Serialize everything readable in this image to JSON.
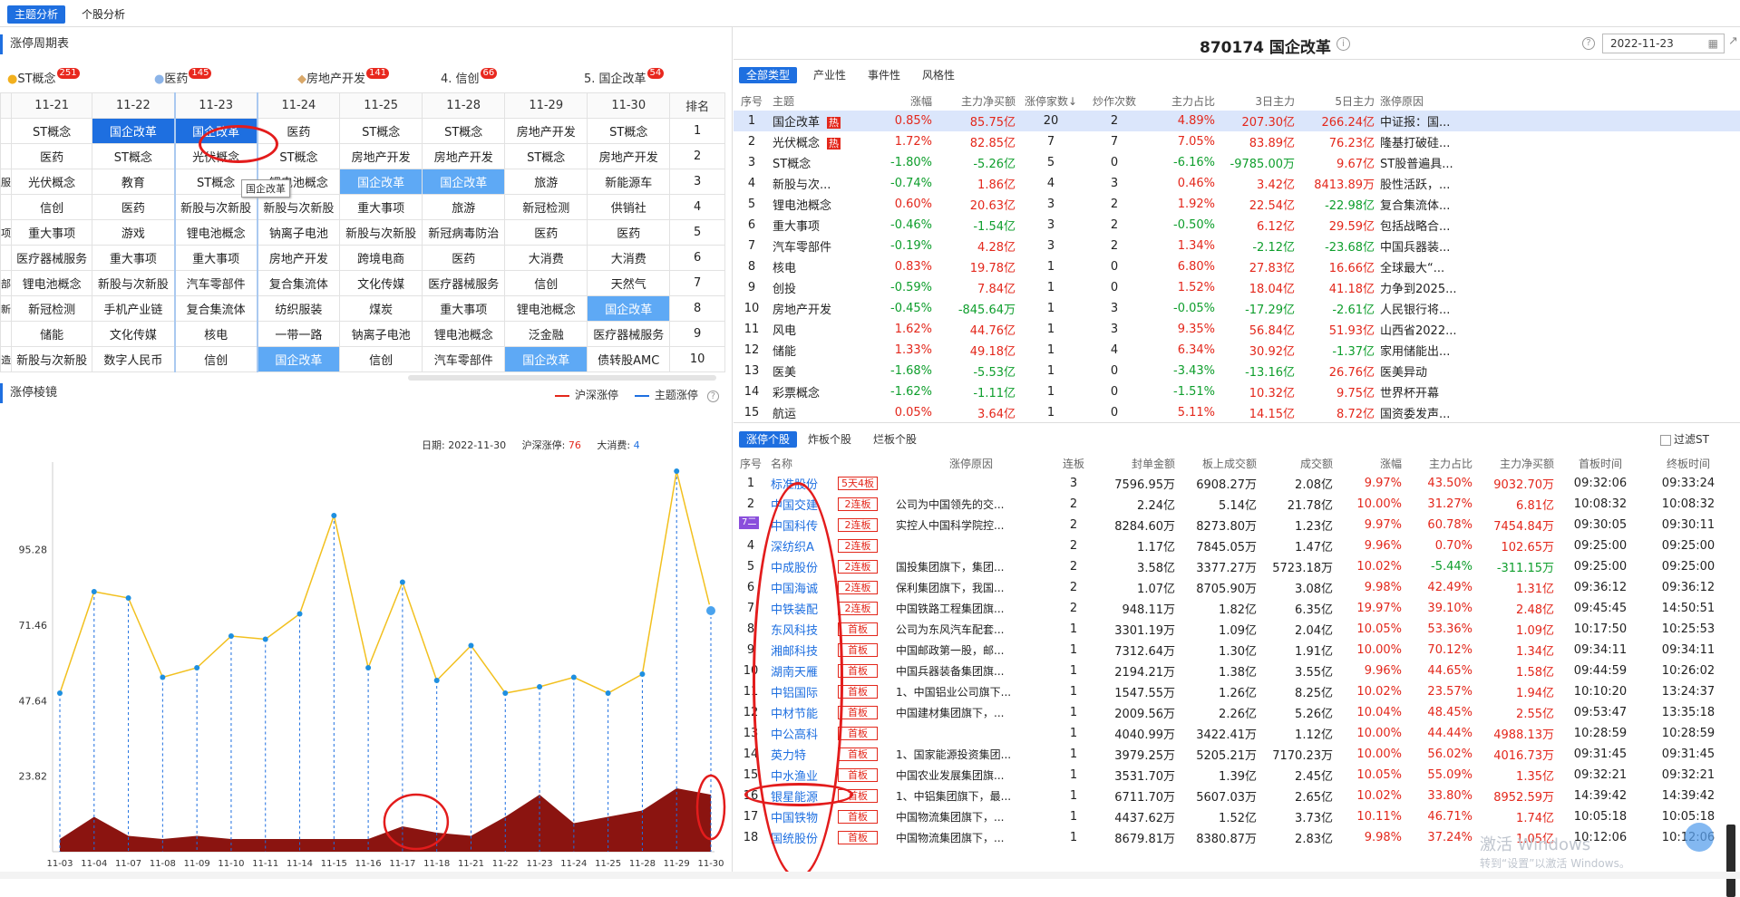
{
  "top_tabs": [
    "主题分析",
    "个股分析"
  ],
  "left": {
    "cycle_title": "涨停周期表",
    "theme_tabs": [
      {
        "label": "ST概念",
        "count": "251"
      },
      {
        "label": "医药",
        "count": "145"
      },
      {
        "label": "房地产开发",
        "count": "141"
      },
      {
        "label": "4. 信创",
        "count": "66"
      },
      {
        "label": "5. 国企改革",
        "count": "54"
      }
    ],
    "dates": [
      "11-21",
      "11-22",
      "11-23",
      "11-24",
      "11-25",
      "11-28",
      "11-29",
      "11-30",
      "排名"
    ],
    "rows": [
      [
        "ST概念",
        "国企改革",
        "国企改革",
        "医药",
        "ST概念",
        "ST概念",
        "房地产开发",
        "ST概念",
        "1"
      ],
      [
        "医药",
        "ST概念",
        "光伏概念",
        "ST概念",
        "房地产开发",
        "房地产开发",
        "ST概念",
        "房地产开发",
        "2"
      ],
      [
        "光伏概念",
        "教育",
        "ST概念",
        "锂电池概念",
        "国企改革",
        "国企改革",
        "旅游",
        "新能源车",
        "3"
      ],
      [
        "信创",
        "医药",
        "新股与次新股",
        "新股与次新股",
        "重大事项",
        "旅游",
        "新冠检测",
        "供销社",
        "4"
      ],
      [
        "重大事项",
        "游戏",
        "锂电池概念",
        "钠离子电池",
        "新股与次新股",
        "新冠病毒防治",
        "医药",
        "医药",
        "5"
      ],
      [
        "医疗器械服务",
        "重大事项",
        "重大事项",
        "房地产开发",
        "跨境电商",
        "医药",
        "大消费",
        "大消费",
        "6"
      ],
      [
        "锂电池概念",
        "新股与次新股",
        "汽车零部件",
        "复合集流体",
        "文化传媒",
        "医疗器械服务",
        "信创",
        "天然气",
        "7"
      ],
      [
        "新冠检测",
        "手机产业链",
        "复合集流体",
        "纺织服装",
        "煤炭",
        "重大事项",
        "锂电池概念",
        "国企改革",
        "8"
      ],
      [
        "储能",
        "文化传媒",
        "核电",
        "一带一路",
        "钠离子电池",
        "锂电池概念",
        "泛金融",
        "医疗器械服务",
        "9"
      ],
      [
        "新股与次新股",
        "数字人民币",
        "信创",
        "国企改革",
        "信创",
        "汽车零部件",
        "国企改革",
        "债转股AMC",
        "10"
      ]
    ],
    "row_prefix": [
      "",
      "",
      "服务",
      "",
      "项",
      "",
      "部件",
      "新股",
      "",
      "造"
    ],
    "tooltip": "国企改革",
    "mirror_title": "涨停棱镜",
    "legend": {
      "a": "沪深涨停",
      "b": "主题涨停"
    },
    "info": {
      "date_label": "日期:",
      "date": "2022-11-30",
      "hs_label": "沪深涨停:",
      "hs": "76",
      "theme_label": "大消费:",
      "theme": "4"
    }
  },
  "chart_data": {
    "type": "line",
    "categories": [
      "11-03",
      "11-04",
      "11-07",
      "11-08",
      "11-09",
      "11-10",
      "11-11",
      "11-14",
      "11-15",
      "11-16",
      "11-17",
      "11-18",
      "11-21",
      "11-22",
      "11-23",
      "11-24",
      "11-25",
      "11-28",
      "11-29",
      "11-30"
    ],
    "yticks": [
      23.82,
      47.64,
      71.46,
      95.28
    ],
    "ylim": [
      0,
      120
    ],
    "series": [
      {
        "name": "沪深涨停",
        "type": "area",
        "color": "#8b1410",
        "values": [
          4,
          11,
          5,
          4,
          5,
          4,
          4,
          4,
          4,
          4,
          8,
          6,
          5,
          11,
          18,
          9,
          11,
          13,
          20,
          18
        ]
      },
      {
        "name": "主题涨停",
        "type": "line",
        "color": "#f2c01e",
        "values": [
          50,
          82,
          80,
          55,
          58,
          68,
          67,
          75,
          106,
          58,
          85,
          54,
          65,
          50,
          52,
          55,
          50,
          56,
          120,
          76
        ]
      }
    ]
  },
  "right": {
    "header_title": "870174 国企改革",
    "date": "2022-11-23",
    "tabs1": [
      "全部类型",
      "产业性",
      "事件性",
      "风格性"
    ],
    "cols1": [
      "序号",
      "主题",
      "涨幅",
      "主力净买额",
      "涨停家数↓",
      "炒作次数",
      "主力占比",
      "3日主力",
      "5日主力",
      "涨停原因"
    ],
    "rows1": [
      [
        "1",
        "国企改革",
        "0.85%",
        "85.75亿",
        "20",
        "2",
        "4.89%",
        "207.30亿",
        "266.24亿",
        "中证报：国..."
      ],
      [
        "2",
        "光伏概念",
        "1.72%",
        "82.85亿",
        "7",
        "7",
        "7.05%",
        "83.89亿",
        "76.23亿",
        "隆基打破硅..."
      ],
      [
        "3",
        "ST概念",
        "-1.80%",
        "-5.26亿",
        "5",
        "0",
        "-6.16%",
        "-9785.00万",
        "9.67亿",
        "ST股普遍具..."
      ],
      [
        "4",
        "新股与次...",
        "-0.74%",
        "1.86亿",
        "4",
        "3",
        "0.46%",
        "3.42亿",
        "8413.89万",
        "股性活跃，..."
      ],
      [
        "5",
        "锂电池概念",
        "0.60%",
        "20.63亿",
        "3",
        "2",
        "1.92%",
        "22.54亿",
        "-22.98亿",
        "复合集流体..."
      ],
      [
        "6",
        "重大事项",
        "-0.46%",
        "-1.54亿",
        "3",
        "2",
        "-0.50%",
        "6.12亿",
        "29.59亿",
        "包括战略合..."
      ],
      [
        "7",
        "汽车零部件",
        "-0.19%",
        "4.28亿",
        "3",
        "2",
        "1.34%",
        "-2.12亿",
        "-23.68亿",
        "中国兵器装..."
      ],
      [
        "8",
        "核电",
        "0.83%",
        "19.78亿",
        "1",
        "0",
        "6.80%",
        "27.83亿",
        "16.66亿",
        "全球最大“..."
      ],
      [
        "9",
        "创投",
        "-0.59%",
        "7.84亿",
        "1",
        "0",
        "1.52%",
        "18.04亿",
        "41.18亿",
        "力争到2025..."
      ],
      [
        "10",
        "房地产开发",
        "-0.45%",
        "-845.64万",
        "1",
        "3",
        "-0.05%",
        "-17.29亿",
        "-2.61亿",
        "人民银行将..."
      ],
      [
        "11",
        "风电",
        "1.62%",
        "44.76亿",
        "1",
        "3",
        "9.35%",
        "56.84亿",
        "51.93亿",
        "山西省2022..."
      ],
      [
        "12",
        "储能",
        "1.33%",
        "49.18亿",
        "1",
        "4",
        "6.34%",
        "30.92亿",
        "-1.37亿",
        "家用储能出..."
      ],
      [
        "13",
        "医美",
        "-1.68%",
        "-5.53亿",
        "1",
        "0",
        "-3.43%",
        "-13.16亿",
        "26.76亿",
        "医美异动"
      ],
      [
        "14",
        "彩票概念",
        "-1.62%",
        "-1.11亿",
        "1",
        "0",
        "-1.51%",
        "10.32亿",
        "9.75亿",
        "世界杯开幕"
      ],
      [
        "15",
        "航运",
        "0.05%",
        "3.64亿",
        "1",
        "0",
        "5.11%",
        "14.15亿",
        "8.72亿",
        "国资委发声..."
      ]
    ],
    "hot_label": "热",
    "tabs2": [
      "涨停个股",
      "炸板个股",
      "烂板个股"
    ],
    "filter_label": "过滤ST",
    "cols2": [
      "序号",
      "名称",
      "",
      "涨停原因",
      "连板",
      "封单金额",
      "板上成交额",
      "成交额",
      "涨幅",
      "主力占比",
      "主力净买额",
      "首板时间",
      "终板时间"
    ],
    "rows2": [
      [
        "1",
        "标准股份",
        "5天4板",
        "",
        "3",
        "7596.95万",
        "6908.27万",
        "2.08亿",
        "9.97%",
        "43.50%",
        "9032.70万",
        "09:32:06",
        "09:33:24"
      ],
      [
        "2",
        "中国交建",
        "2连板",
        "公司为中国领先的交...",
        "2",
        "2.24亿",
        "5.14亿",
        "21.78亿",
        "10.00%",
        "31.27%",
        "6.81亿",
        "10:08:32",
        "10:08:32"
      ],
      [
        "3",
        "中国科传",
        "2连板",
        "实控人中国科学院控...",
        "2",
        "8284.60万",
        "8273.80万",
        "1.23亿",
        "9.97%",
        "60.78%",
        "7454.84万",
        "09:30:05",
        "09:30:11"
      ],
      [
        "4",
        "深纺织A",
        "2连板",
        "",
        "2",
        "1.17亿",
        "7845.05万",
        "1.47亿",
        "9.96%",
        "0.70%",
        "102.65万",
        "09:25:00",
        "09:25:00"
      ],
      [
        "5",
        "中成股份",
        "2连板",
        "国投集团旗下，集团...",
        "2",
        "3.58亿",
        "3377.27万",
        "5723.18万",
        "10.02%",
        "-5.44%",
        "-311.15万",
        "09:25:00",
        "09:25:00"
      ],
      [
        "6",
        "中国海诚",
        "2连板",
        "保利集团旗下，我国...",
        "2",
        "1.07亿",
        "8705.90万",
        "3.08亿",
        "9.98%",
        "42.49%",
        "1.31亿",
        "09:36:12",
        "09:36:12"
      ],
      [
        "7",
        "中铁装配",
        "2连板",
        "中国铁路工程集团旗...",
        "2",
        "948.11万",
        "1.82亿",
        "6.35亿",
        "19.97%",
        "39.10%",
        "2.48亿",
        "09:45:45",
        "14:50:51"
      ],
      [
        "8",
        "东风科技",
        "首板",
        "公司为东风汽车配套...",
        "1",
        "3301.19万",
        "1.09亿",
        "2.04亿",
        "10.05%",
        "53.36%",
        "1.09亿",
        "10:17:50",
        "10:25:53"
      ],
      [
        "9",
        "湘邮科技",
        "首板",
        "中国邮政第一股，邮...",
        "1",
        "7312.64万",
        "1.30亿",
        "1.91亿",
        "10.00%",
        "70.12%",
        "1.34亿",
        "09:34:11",
        "09:34:11"
      ],
      [
        "10",
        "湖南天雁",
        "首板",
        "中国兵器装备集团旗...",
        "1",
        "2194.21万",
        "1.38亿",
        "3.55亿",
        "9.96%",
        "44.65%",
        "1.58亿",
        "09:44:59",
        "10:26:02"
      ],
      [
        "11",
        "中铝国际",
        "首板",
        "1、中国铝业公司旗下...",
        "1",
        "1547.55万",
        "1.26亿",
        "8.25亿",
        "10.02%",
        "23.57%",
        "1.94亿",
        "10:10:20",
        "13:24:37"
      ],
      [
        "12",
        "中材节能",
        "首板",
        "中国建材集团旗下，...",
        "1",
        "2009.56万",
        "2.26亿",
        "5.26亿",
        "10.04%",
        "48.45%",
        "2.55亿",
        "09:53:47",
        "13:35:18"
      ],
      [
        "13",
        "中公高科",
        "首板",
        "",
        "1",
        "4040.99万",
        "3422.41万",
        "1.12亿",
        "10.00%",
        "44.44%",
        "4988.13万",
        "10:28:59",
        "10:28:59"
      ],
      [
        "14",
        "英力特",
        "首板",
        "1、国家能源投资集团...",
        "1",
        "3979.25万",
        "5205.21万",
        "7170.23万",
        "10.00%",
        "56.02%",
        "4016.73万",
        "09:31:45",
        "09:31:45"
      ],
      [
        "15",
        "中水渔业",
        "首板",
        "中国农业发展集团旗...",
        "1",
        "3531.70万",
        "1.39亿",
        "2.45亿",
        "10.05%",
        "55.09%",
        "1.35亿",
        "09:32:21",
        "09:32:21"
      ],
      [
        "16",
        "银星能源",
        "首板",
        "1、中铝集团旗下，最...",
        "1",
        "6711.70万",
        "5607.03万",
        "2.65亿",
        "10.02%",
        "33.80%",
        "8952.59万",
        "14:39:42",
        "14:39:42"
      ],
      [
        "17",
        "中国铁物",
        "首板",
        "中国物流集团旗下，...",
        "1",
        "4437.62万",
        "1.52亿",
        "3.73亿",
        "10.11%",
        "46.71%",
        "1.74亿",
        "10:05:18",
        "10:05:18"
      ],
      [
        "18",
        "国统股份",
        "首板",
        "中国物流集团旗下，...",
        "1",
        "8679.81万",
        "8380.87万",
        "2.83亿",
        "9.98%",
        "37.24%",
        "1.05亿",
        "10:12:06",
        "10:12:06"
      ]
    ],
    "special_tag": "7二",
    "watermark": {
      "line1": "激活 Windows",
      "line2": "转到“设置”以激活 Windows。"
    }
  }
}
